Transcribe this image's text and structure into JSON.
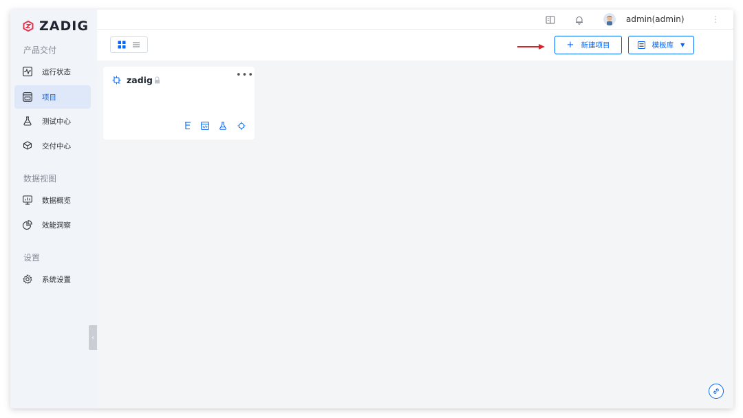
{
  "brand": {
    "name": "ZADIG",
    "color": "#e6334c",
    "accent": "#0066ff"
  },
  "sidebar": {
    "sections": [
      {
        "title": "产品交付"
      },
      {
        "title": "数据视图"
      },
      {
        "title": "设置"
      }
    ],
    "items": [
      {
        "label": "运行状态",
        "icon": "activity-icon"
      },
      {
        "label": "项目",
        "icon": "project-icon",
        "active": true
      },
      {
        "label": "测试中心",
        "icon": "flask-icon"
      },
      {
        "label": "交付中心",
        "icon": "delivery-icon"
      },
      {
        "label": "数据概览",
        "icon": "monitor-chart-icon"
      },
      {
        "label": "效能洞察",
        "icon": "pie-chart-icon"
      },
      {
        "label": "系统设置",
        "icon": "gear-icon"
      }
    ],
    "collapse_glyph": "‹"
  },
  "header": {
    "username": "admin(admin)",
    "more_glyph": "⋮"
  },
  "toolbar": {
    "new_project_label": "新建项目",
    "new_project_plus": "+",
    "template_label": "模板库",
    "template_caret": "▼"
  },
  "project_card": {
    "name": "zadig",
    "more_glyph": "•••"
  }
}
